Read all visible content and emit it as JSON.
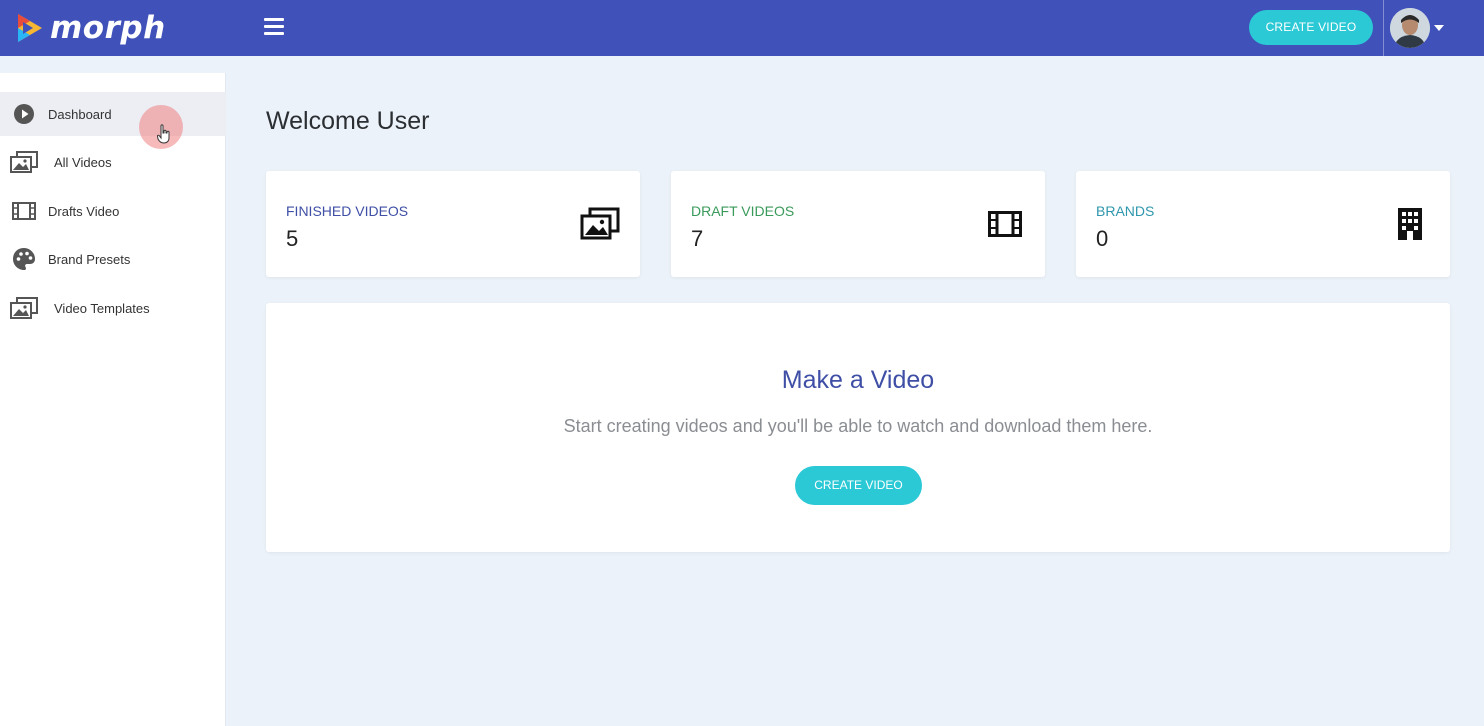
{
  "app": {
    "name": "morph"
  },
  "header": {
    "create_label": "CREATE VIDEO",
    "menu_icon": "hamburger-icon",
    "avatar_icon": "user-avatar"
  },
  "sidebar": {
    "items": [
      {
        "label": "Dashboard",
        "icon": "play-circle-icon",
        "active": true
      },
      {
        "label": "All Videos",
        "icon": "photo-gallery-icon",
        "active": false
      },
      {
        "label": "Drafts Video",
        "icon": "film-icon",
        "active": false
      },
      {
        "label": "Brand Presets",
        "icon": "palette-icon",
        "active": false
      },
      {
        "label": "Video Templates",
        "icon": "photo-gallery-icon",
        "active": false
      }
    ]
  },
  "main": {
    "welcome": "Welcome User",
    "cards": [
      {
        "title": "FINISHED VIDEOS",
        "value": "5",
        "color": "#3f4fa6",
        "icon": "photo-gallery-icon"
      },
      {
        "title": "DRAFT VIDEOS",
        "value": "7",
        "color": "#3a9a5b",
        "icon": "film-icon"
      },
      {
        "title": "BRANDS",
        "value": "0",
        "color": "#2f97ad",
        "icon": "building-icon"
      }
    ],
    "panel": {
      "title": "Make a Video",
      "subtitle": "Start creating videos and you'll be able to watch and download them here.",
      "button_label": "CREATE VIDEO"
    }
  },
  "colors": {
    "topbar": "#4052b9",
    "accent": "#2bc8d6",
    "background": "#ebf2f9"
  }
}
